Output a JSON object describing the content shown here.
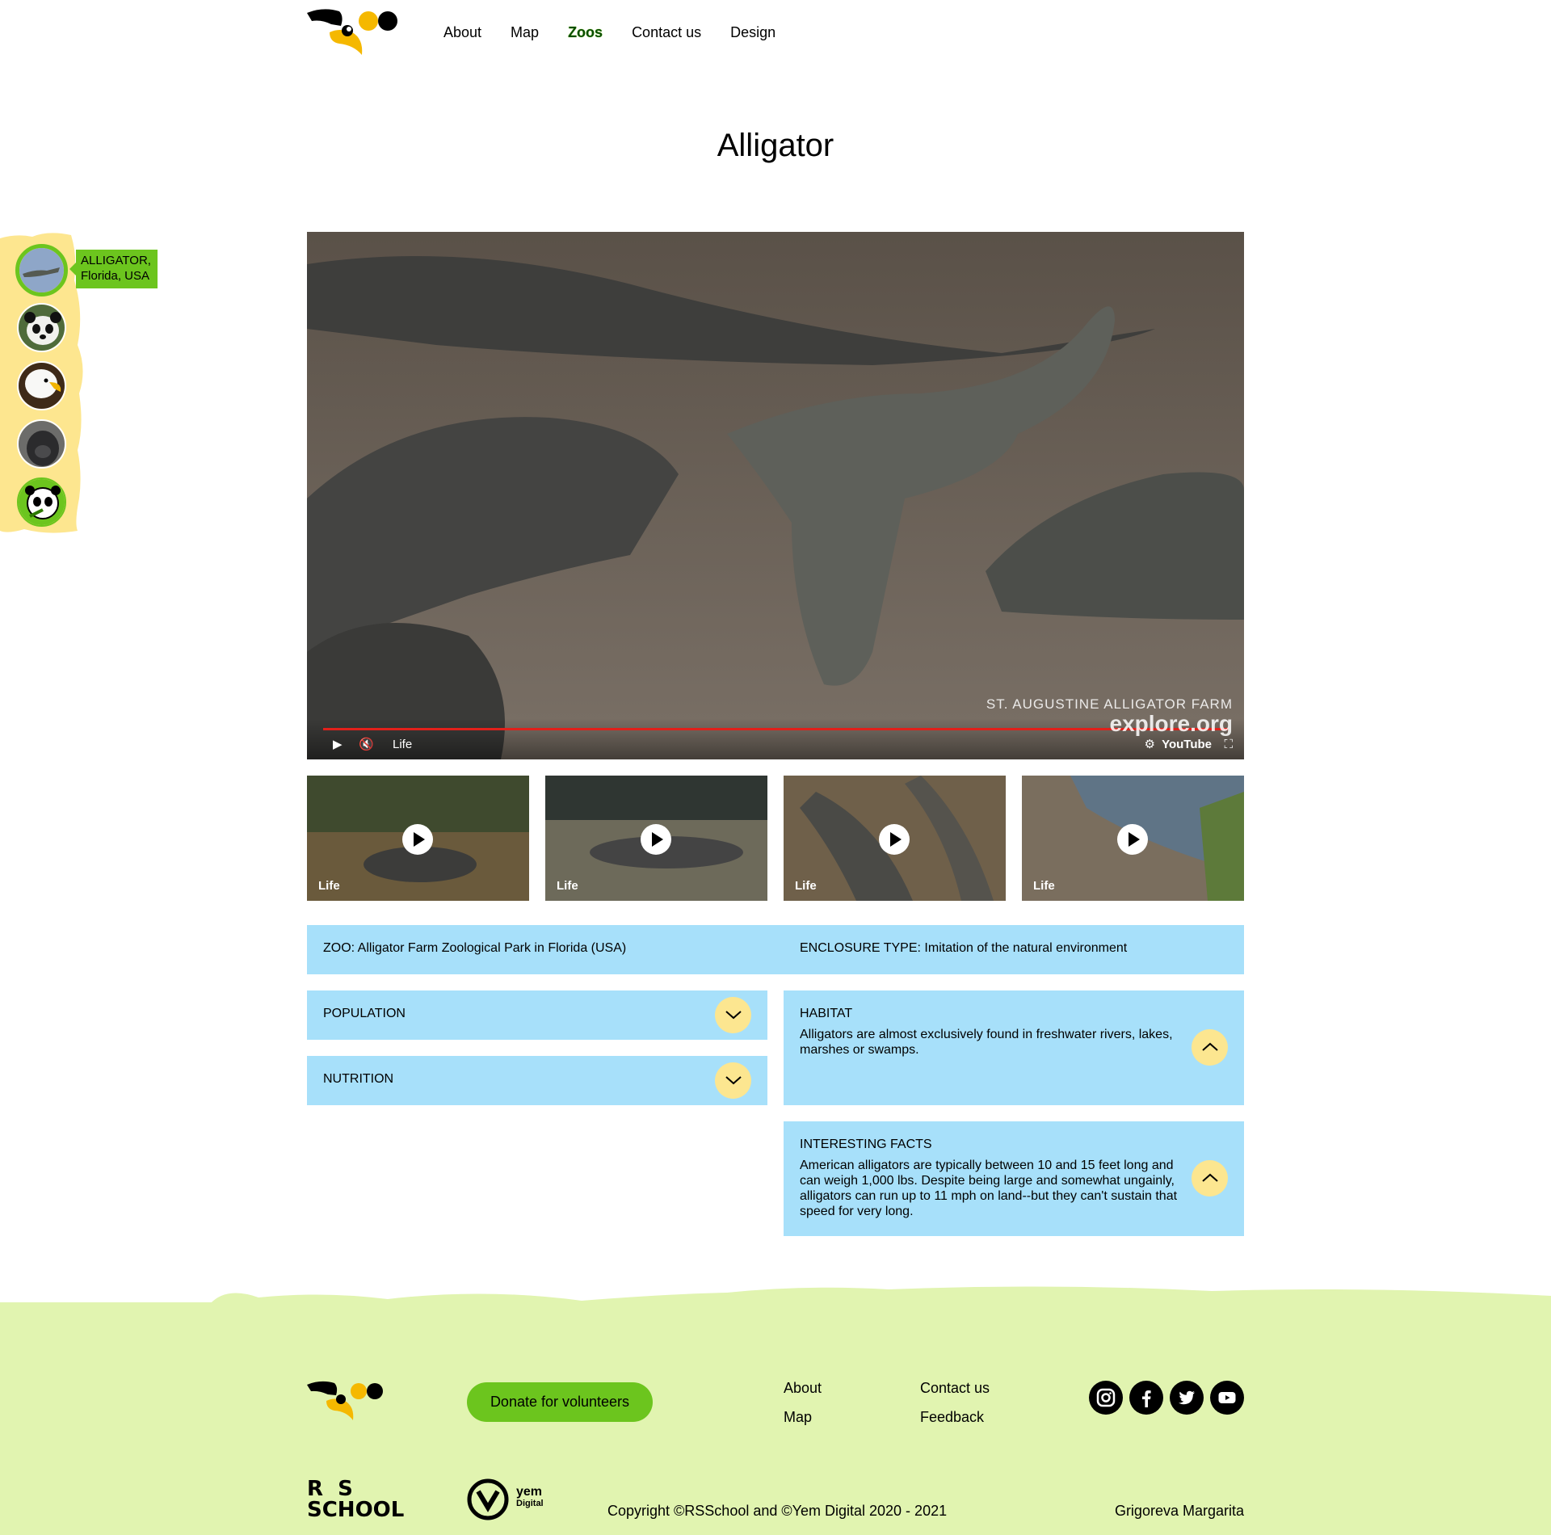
{
  "nav": {
    "items": [
      "About",
      "Map",
      "Zoos",
      "Contact us",
      "Design"
    ],
    "active": "Zoos"
  },
  "page": {
    "title": "Alligator"
  },
  "sidebar": {
    "tooltip": {
      "line1": "ALLIGATOR,",
      "line2": "Florida, USA"
    },
    "animals": [
      "alligator",
      "panda",
      "eagle",
      "gorilla",
      "panda-logo"
    ]
  },
  "video": {
    "live_label": "Life",
    "watermark_line1": "ST. AUGUSTINE ALLIGATOR FARM",
    "watermark_line2": "explore.org",
    "youtube_label": "YouTube"
  },
  "thumbnails": [
    {
      "label": "Life"
    },
    {
      "label": "Life"
    },
    {
      "label": "Life"
    },
    {
      "label": "Life"
    }
  ],
  "info": {
    "zoo": "ZOO: Alligator Farm Zoological Park in Florida (USA)",
    "enclosure": "ENCLOSURE TYPE: Imitation of the natural environment",
    "population_title": "POPULATION",
    "nutrition_title": "NUTRITION",
    "habitat_title": "HABITAT",
    "habitat_text": "Alligators are almost exclusively found in freshwater rivers, lakes, marshes or swamps.",
    "facts_title": "INTERESTING FACTS",
    "facts_text": "American alligators are typically between 10 and 15 feet long and can weigh 1,000 lbs.  Despite being large and somewhat ungainly, alligators can run up to 11 mph on land--but they can't sustain that speed for very long."
  },
  "footer": {
    "donate": "Donate for volunteers",
    "links": {
      "about": "About",
      "map": "Map",
      "contact": "Contact us",
      "feedback": "Feedback"
    },
    "rs_line1": "R  S",
    "rs_line2": "SCHOOL",
    "yem_line1": "yem",
    "yem_line2": "Digital",
    "copyright": "Copyright ©RSSchool and ©Yem Digital 2020 - 2021",
    "author": "Grigoreva Margarita"
  },
  "colors": {
    "accent_green": "#6cc51e",
    "info_blue": "#a7e0fa",
    "chevron_yellow": "#fce690",
    "footer_green": "#e1f4b0",
    "sidebar_yellow": "#fde68f"
  }
}
